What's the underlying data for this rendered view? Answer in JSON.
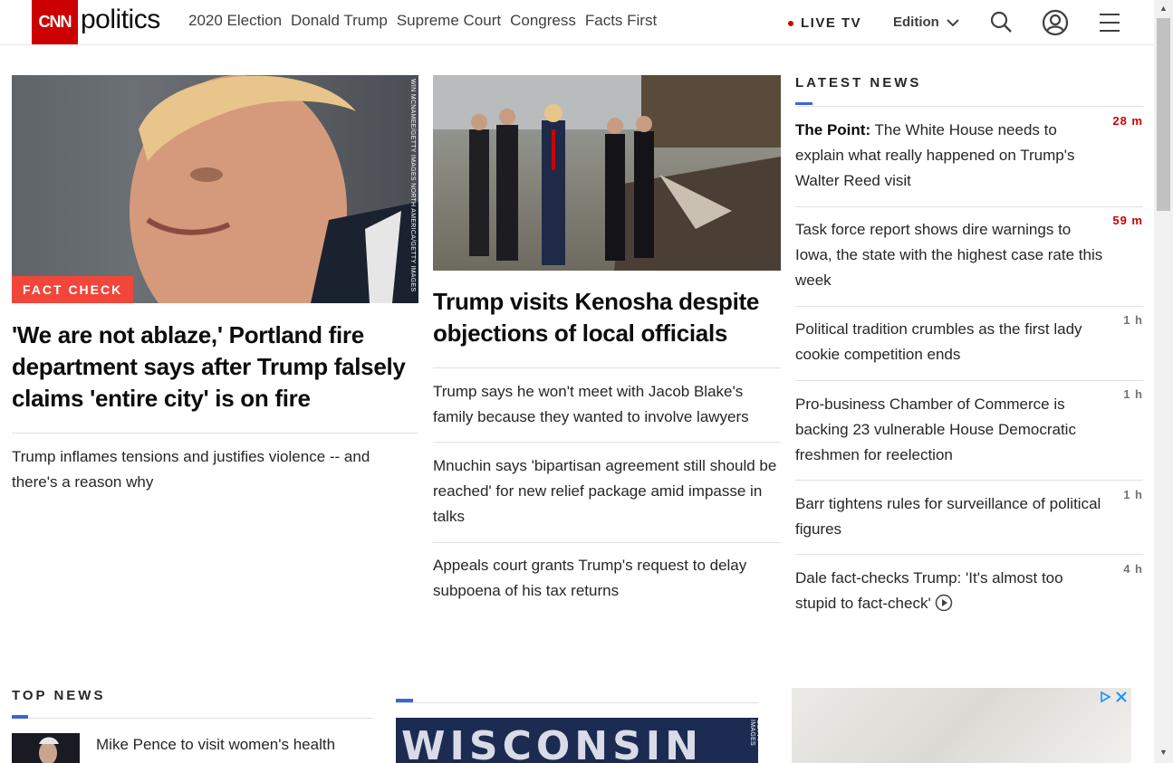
{
  "header": {
    "logo_text": "CNN",
    "section_word": "politics",
    "nav_items": [
      "2020 Election",
      "Donald Trump",
      "Supreme Court",
      "Congress",
      "Facts First"
    ],
    "live_tv_label": "LIVE TV",
    "edition_label": "Edition"
  },
  "left_column": {
    "image_credit": "WIN MCNAMEE/GETTY IMAGES NORTH AMERICA/GETTY IMAGES",
    "tag": "FACT CHECK",
    "headline": "'We are not ablaze,' Portland fire department says after Trump falsely claims 'entire city' is on fire",
    "related": [
      "Trump inflames tensions and justifies violence -- and there's a reason why"
    ]
  },
  "center_column": {
    "headline": "Trump visits Kenosha despite objections of local officials",
    "related": [
      "Trump says he won't meet with Jacob Blake's family because they wanted to involve lawyers",
      "Mnuchin says 'bipartisan agreement still should be reached' for new relief package amid impasse in talks",
      "Appeals court grants Trump's request to delay subpoena of his tax returns"
    ]
  },
  "latest_news": {
    "title": "LATEST NEWS",
    "items": [
      {
        "prefix": "The Point:",
        "text": " The White House needs to explain what really happened on Trump's Walter Reed visit",
        "time": "28 m",
        "recent": true
      },
      {
        "prefix": "",
        "text": "Task force report shows dire warnings to Iowa, the state with the highest case rate this week",
        "time": "59 m",
        "recent": true
      },
      {
        "prefix": "",
        "text": "Political tradition crumbles as the first lady cookie competition ends",
        "time": "1 h",
        "recent": false
      },
      {
        "prefix": "",
        "text": "Pro-business Chamber of Commerce is backing 23 vulnerable House Democratic freshmen for reelection",
        "time": "1 h",
        "recent": false
      },
      {
        "prefix": "",
        "text": "Barr tightens rules for surveillance of political figures",
        "time": "1 h",
        "recent": false
      },
      {
        "prefix": "",
        "text": "Dale fact-checks Trump: 'It's almost too stupid to fact-check'",
        "time": "4 h",
        "recent": false
      }
    ]
  },
  "top_news": {
    "title": "TOP NEWS",
    "first_item": "Mike Pence to visit women's health"
  },
  "bottom_center": {
    "image_text": "WISCONSIN",
    "image_credit": "GETTY IMAGES"
  },
  "colors": {
    "brand_red": "#cc0000",
    "tag_red": "#f2463b",
    "accent_blue": "#3b65d9",
    "time_red": "#cc0000",
    "time_gray": "#737373"
  }
}
